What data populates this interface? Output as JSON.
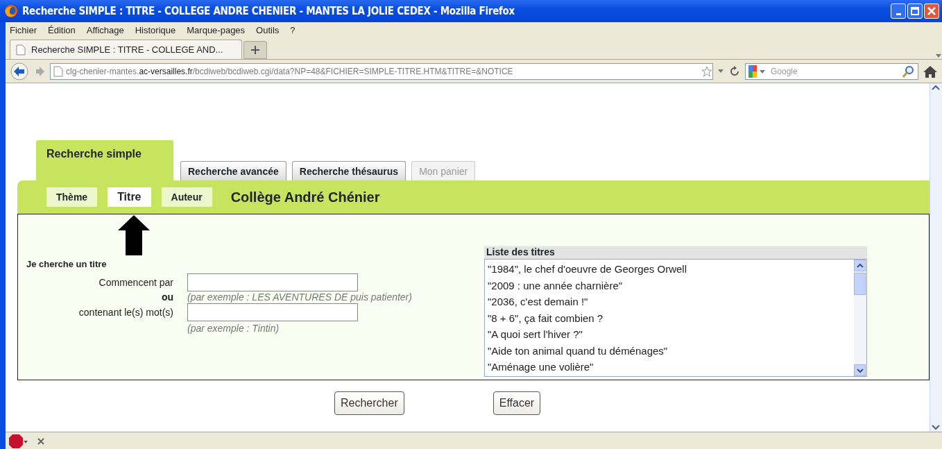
{
  "window": {
    "title": "Recherche SIMPLE : TITRE - COLLEGE ANDRE CHENIER - MANTES LA JOLIE CEDEX - Mozilla Firefox"
  },
  "menu": [
    "Fichier",
    "Édition",
    "Affichage",
    "Historique",
    "Marque-pages",
    "Outils",
    "?"
  ],
  "browser_tabs": [
    {
      "label": "Recherche SIMPLE : TITRE - COLLEGE AND...",
      "selected": true
    }
  ],
  "address_bar": {
    "url_parts": [
      {
        "text": "clg-chenier-mantes.",
        "dim": true
      },
      {
        "text": "ac-versailles.fr",
        "dim": false
      },
      {
        "text": "/bcdiweb/bcdiweb.cgi/data?NP=48&FICHIER=SIMPLE-TITRE.HTM&TITRE=&NOTICE",
        "dim": true
      }
    ]
  },
  "search": {
    "placeholder": "Google"
  },
  "page": {
    "tabs": [
      {
        "label": "Recherche simple",
        "selected": true,
        "disabled": false
      },
      {
        "label": "Recherche avancée",
        "selected": false,
        "disabled": false
      },
      {
        "label": "Recherche thésaurus",
        "selected": false,
        "disabled": false
      },
      {
        "label": "Mon panier",
        "selected": false,
        "disabled": true
      }
    ],
    "subtabs": [
      {
        "label": "Thème",
        "selected": false
      },
      {
        "label": "Titre",
        "selected": true
      },
      {
        "label": "Auteur",
        "selected": false
      }
    ],
    "school": "Collège André Chénier",
    "form": {
      "heading": "Je cherche un titre",
      "starts_label": "Commencent par",
      "or_label": "ou",
      "starts_hint": "(par exemple : LES AVENTURES DE puis patienter)",
      "contains_label": "contenant le(s) mot(s)",
      "contains_hint": "(par exemple : Tintin)"
    },
    "titles_list": {
      "heading": "Liste des titres",
      "items": [
        {
          "label": "\"1984\", le chef d'oeuvre de Georges Orwell",
          "selected": false
        },
        {
          "label": "\"2009 : une année charnière\"",
          "selected": false
        },
        {
          "label": "\"2036, c'est demain !\"",
          "selected": false
        },
        {
          "label": "\"8 + 6\", ça fait combien ?",
          "selected": false
        },
        {
          "label": "\"A quoi sert l'hiver ?\"",
          "selected": false
        },
        {
          "label": "\"Aide ton animal quand tu déménages\"",
          "selected": false
        },
        {
          "label": "\"Aménage une volière\"",
          "selected": false
        }
      ]
    },
    "buttons": [
      "Rechercher",
      "Effacer"
    ]
  }
}
